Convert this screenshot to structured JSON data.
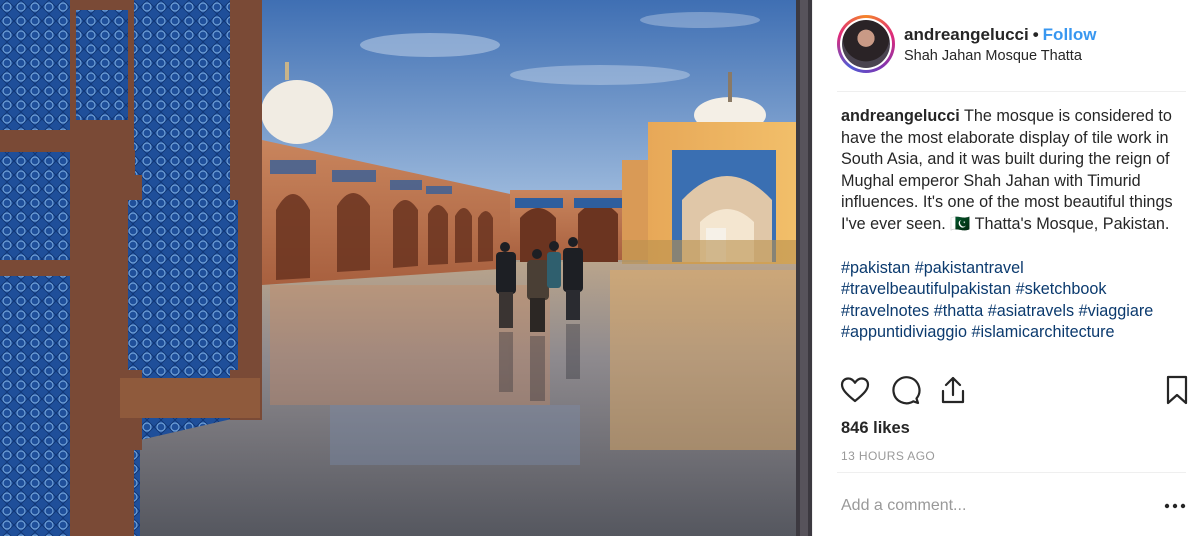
{
  "post": {
    "username": "andreangelucci",
    "separator": "•",
    "follow_label": "Follow",
    "location": "Shah Jahan Mosque Thatta",
    "caption_text": "The mosque is considered to have the most elaborate display of tile work in South Asia, and it was built during the reign of Mughal emperor Shah Jahan with Timurid influences. It's one of the most beautiful things I've ever seen. 🇵🇰 Thatta's Mosque, Pakistan.",
    "hashtags": [
      "#pakistan",
      "#pakistantravel",
      "#travelbeautifulpakistan",
      "#sketchbook",
      "#travelnotes",
      "#thatta",
      "#asiatravels",
      "#viaggiare",
      "#appuntidiviaggio",
      "#islamicarchitecture"
    ],
    "likes": "846 likes",
    "timestamp": "13 HOURS AGO",
    "comment_placeholder": "Add a comment..."
  },
  "icons": {
    "like": "heart-icon",
    "comment": "comment-bubble-icon",
    "share": "share-icon",
    "save": "bookmark-icon",
    "more": "more-options-icon"
  },
  "colors": {
    "link": "#3897f0",
    "hashtag": "#003569",
    "text": "#262626",
    "muted": "#999999"
  }
}
